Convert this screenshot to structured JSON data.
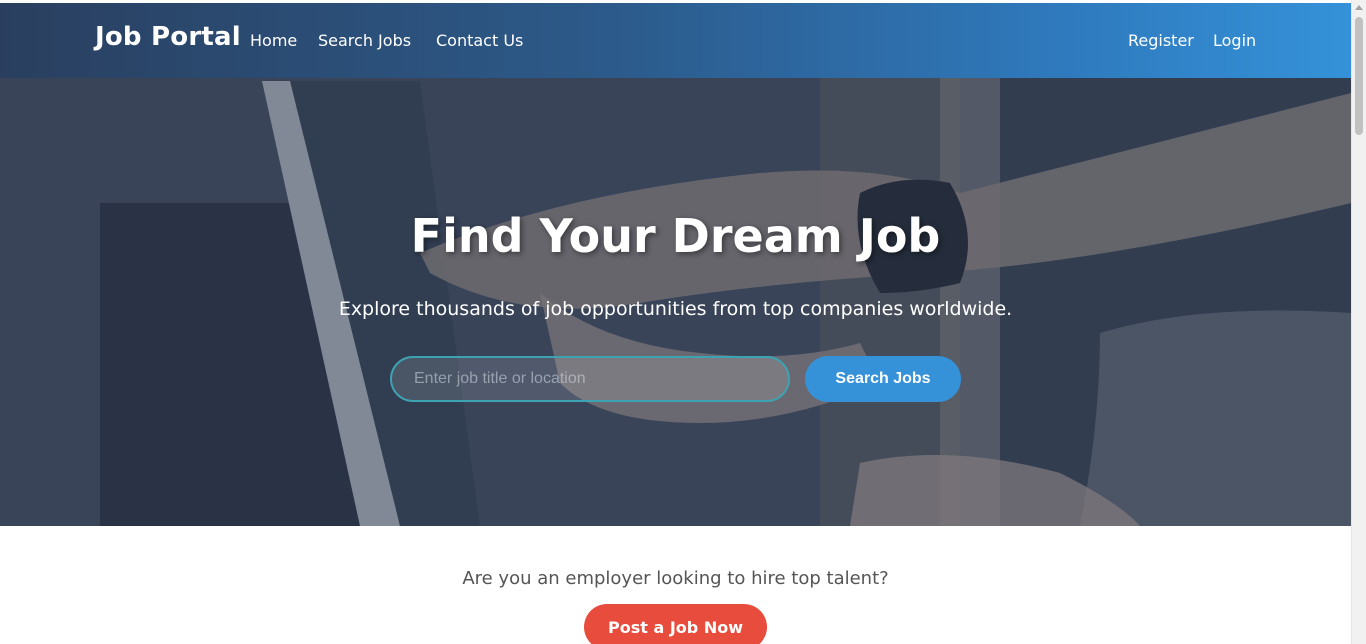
{
  "header": {
    "logo": "Job Portal",
    "nav": [
      {
        "label": "Home"
      },
      {
        "label": "Search Jobs"
      },
      {
        "label": "Contact Us"
      }
    ],
    "auth": [
      {
        "label": "Register"
      },
      {
        "label": "Login"
      }
    ]
  },
  "hero": {
    "title": "Find Your Dream Job",
    "subtitle": "Explore thousands of job opportunities from top companies worldwide.",
    "search": {
      "placeholder": "Enter job title or location",
      "button_label": "Search Jobs"
    }
  },
  "employer_cta": {
    "text": "Are you an employer looking to hire top talent?",
    "button_label": "Post a Job Now"
  },
  "colors": {
    "header_start": "#2a3f5f",
    "header_end": "#3592d8",
    "search_button": "#3592d8",
    "cta_button": "#e74c3c"
  }
}
